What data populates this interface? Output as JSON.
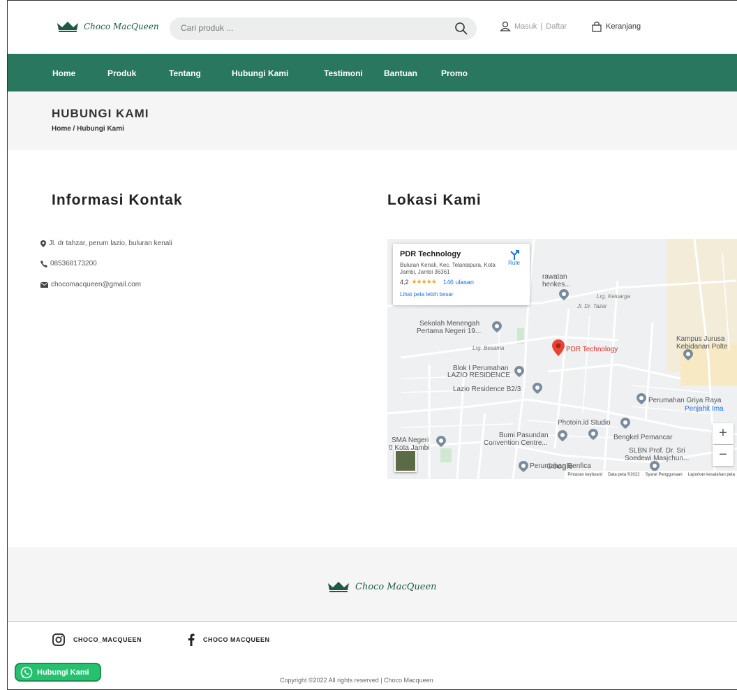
{
  "brand": {
    "name": "Choco MacQueen",
    "color": "#1d5a47"
  },
  "search": {
    "placeholder": "Cari produk ..."
  },
  "account": {
    "login": "Masuk",
    "separator": "|",
    "register": "Daftar"
  },
  "cart": {
    "label": "Keranjang"
  },
  "nav": {
    "color": "#2a7760",
    "items": [
      "Home",
      "Produk",
      "Tentang",
      "Hubungi Kami",
      "Testimoni",
      "Bantuan",
      "Promo"
    ]
  },
  "page": {
    "title": "HUBUNGI KAMI",
    "breadcrumb": "Home / Hubungi Kami"
  },
  "contact": {
    "heading": "Informasi Kontak",
    "address": "Jl. dr tahzar, perum lazio, buluran kenali",
    "phone": "085368173200",
    "email": "chocomacqueen@gmail.com"
  },
  "location": {
    "heading": "Lokasi Kami",
    "card": {
      "title": "PDR Technology",
      "address": "Buluran Kenali, Kec. Telanaipura, Kota Jambi, Jambi 36361",
      "rating": "4,2",
      "stars": "★★★★★",
      "reviews": "146 ulasan",
      "bigger_map": "Lihat peta lebih besar",
      "route": "Rute"
    },
    "labels": {
      "pdr": "PDR Technology",
      "smp": "Sekolah Menengah",
      "smp2": "Pertama Negeri 19...",
      "blok": "Blok I Perumahan",
      "lazio": "LAZIO RESIDENCE",
      "lazio_b": "Lazio Residence B2/3",
      "kampus": "Kampus Jurusa",
      "kebidanan": "Kebidanan Polte",
      "griya": "Perumahan Griya Raya",
      "penjahit": "Penjahit Ima",
      "photoin": "Photoin.id Studio",
      "bumi": "Bumi Pasundan",
      "convention": "Convention Centre...",
      "bengkel": "Bengkel Pemancar",
      "slbn": "SLBN Prof. Dr. Sri",
      "slbn2": "Soedewi Masjchun...",
      "sma": "SMA Negeri",
      "sma2": "0 Kota Jambi",
      "benfica": "Perumahan Benfica",
      "perawatan": "rawatan",
      "kes": "henkes...",
      "st_besama": "Lrg. Besama",
      "st_tazar": "Jl. Dr. Tazar",
      "st_kelurga": "Lrg. Keluarga",
      "google": "Google"
    },
    "footer": {
      "shortcuts": "Pintasan keyboard",
      "data": "Data peta ©2022",
      "terms": "Syarat Penggunaan",
      "report": "Laporkan kesalahan peta"
    },
    "zoom_in": "+",
    "zoom_out": "−"
  },
  "footer": {
    "instagram": "CHOCO_MACQUEEN",
    "facebook": "CHOCO MACQUEEN",
    "copyright": "Copyright ©2022 All rights reserved | Choco Macqueen",
    "whatsapp": "Hubungi Kami"
  }
}
